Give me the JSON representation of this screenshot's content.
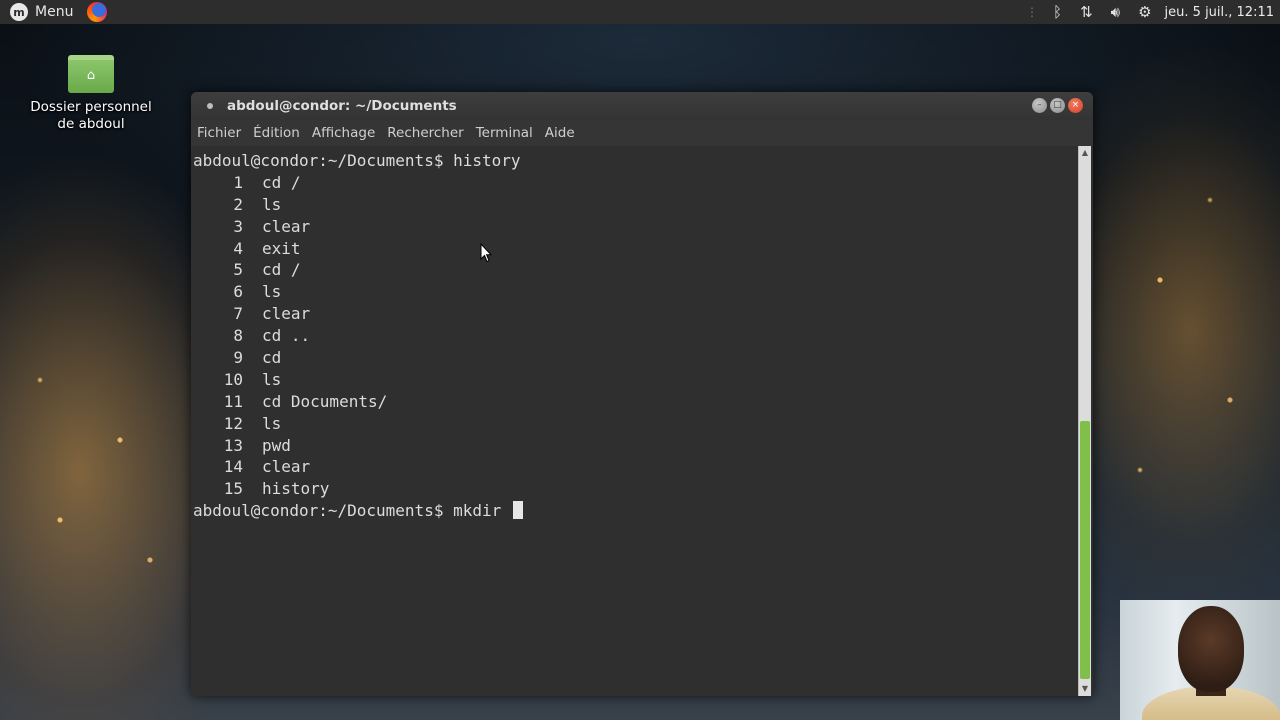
{
  "panel": {
    "menu_label": "Menu",
    "clock": "jeu. 5 juil., 12:11",
    "tray_icons": [
      "bluetooth-icon",
      "network-icon",
      "volume-icon",
      "settings-icon"
    ]
  },
  "desktop": {
    "icon_label_line1": "Dossier personnel",
    "icon_label_line2": "de abdoul"
  },
  "terminal": {
    "title": "abdoul@condor: ~/Documents",
    "menu": [
      "Fichier",
      "Édition",
      "Affichage",
      "Rechercher",
      "Terminal",
      "Aide"
    ],
    "prompt": "abdoul@condor:~/Documents$",
    "first_command": "history",
    "history": [
      {
        "n": "1",
        "cmd": "cd /"
      },
      {
        "n": "2",
        "cmd": "ls"
      },
      {
        "n": "3",
        "cmd": "clear"
      },
      {
        "n": "4",
        "cmd": "exit"
      },
      {
        "n": "5",
        "cmd": "cd /"
      },
      {
        "n": "6",
        "cmd": "ls"
      },
      {
        "n": "7",
        "cmd": "clear"
      },
      {
        "n": "8",
        "cmd": "cd .."
      },
      {
        "n": "9",
        "cmd": "cd"
      },
      {
        "n": "10",
        "cmd": "ls"
      },
      {
        "n": "11",
        "cmd": "cd Documents/"
      },
      {
        "n": "12",
        "cmd": "ls"
      },
      {
        "n": "13",
        "cmd": "pwd"
      },
      {
        "n": "14",
        "cmd": "clear"
      },
      {
        "n": "15",
        "cmd": "history"
      }
    ],
    "current_input": "mkdir "
  },
  "colors": {
    "terminal_bg": "#2f2f2f",
    "scroll_thumb": "#7fbf4a",
    "close_button": "#d4402a"
  }
}
